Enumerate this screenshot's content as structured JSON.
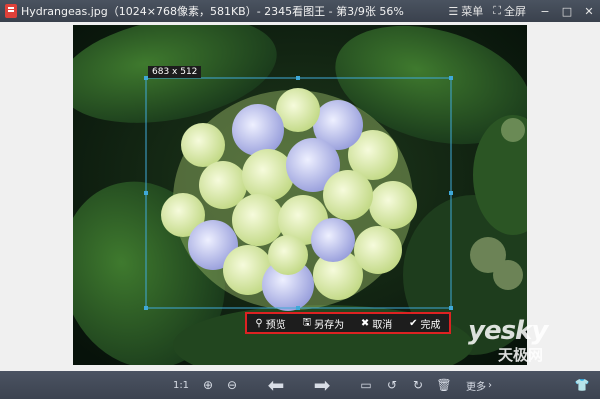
{
  "titlebar": {
    "title": "Hydrangeas.jpg（1024×768像素，581KB）- 2345看图王 - 第3/9张 56%",
    "menu_label": "菜单",
    "fullscreen_label": "全屏"
  },
  "image": {
    "selection_size": "683 x 512"
  },
  "crop_actions": {
    "preview": "预览",
    "save_as": "另存为",
    "cancel": "取消",
    "done": "完成"
  },
  "bottom_toolbar": {
    "actual_size": "1:1",
    "more": "更多"
  },
  "watermark": {
    "line1": "yesky",
    "line2": "天极网"
  }
}
